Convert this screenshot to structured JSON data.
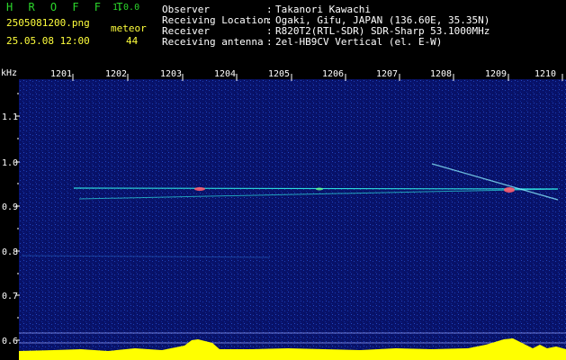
{
  "app": {
    "name": "H R O F F T",
    "version": "1.0.0"
  },
  "file": {
    "name": "2505081200.png",
    "datetime": "25.05.08 12:00"
  },
  "meteor": {
    "label": "meteor",
    "count": "44"
  },
  "info": [
    {
      "key": "Observer",
      "sep": ":",
      "value": "Takanori Kawachi"
    },
    {
      "key": "Receiving Location",
      "sep": ":",
      "value": "Ogaki, Gifu, JAPAN (136.60E, 35.35N)"
    },
    {
      "key": "Receiver",
      "sep": ":",
      "value": "R820T2(RTL-SDR) SDR-Sharp 53.1000MHz"
    },
    {
      "key": "Receiving antenna",
      "sep": ":",
      "value": "2el-HB9CV Vertical (el. E-W)"
    }
  ],
  "axis": {
    "unit": "kHz",
    "time_labels": [
      "1201",
      "1202",
      "1203",
      "1204",
      "1205",
      "1206",
      "1207",
      "1208",
      "1209",
      "1210"
    ],
    "freq_labels": [
      "1.1",
      "1.0",
      "0.9",
      "0.8",
      "0.7",
      "0.6"
    ]
  },
  "colors": {
    "background": "#000000",
    "spectrogram": "#09146e",
    "title_green": "#2bd62b",
    "text_yellow": "#ffff3c",
    "text_white": "#ffffff",
    "signal_cyan": "#33ffee",
    "level_yellow": "#ffff00"
  }
}
